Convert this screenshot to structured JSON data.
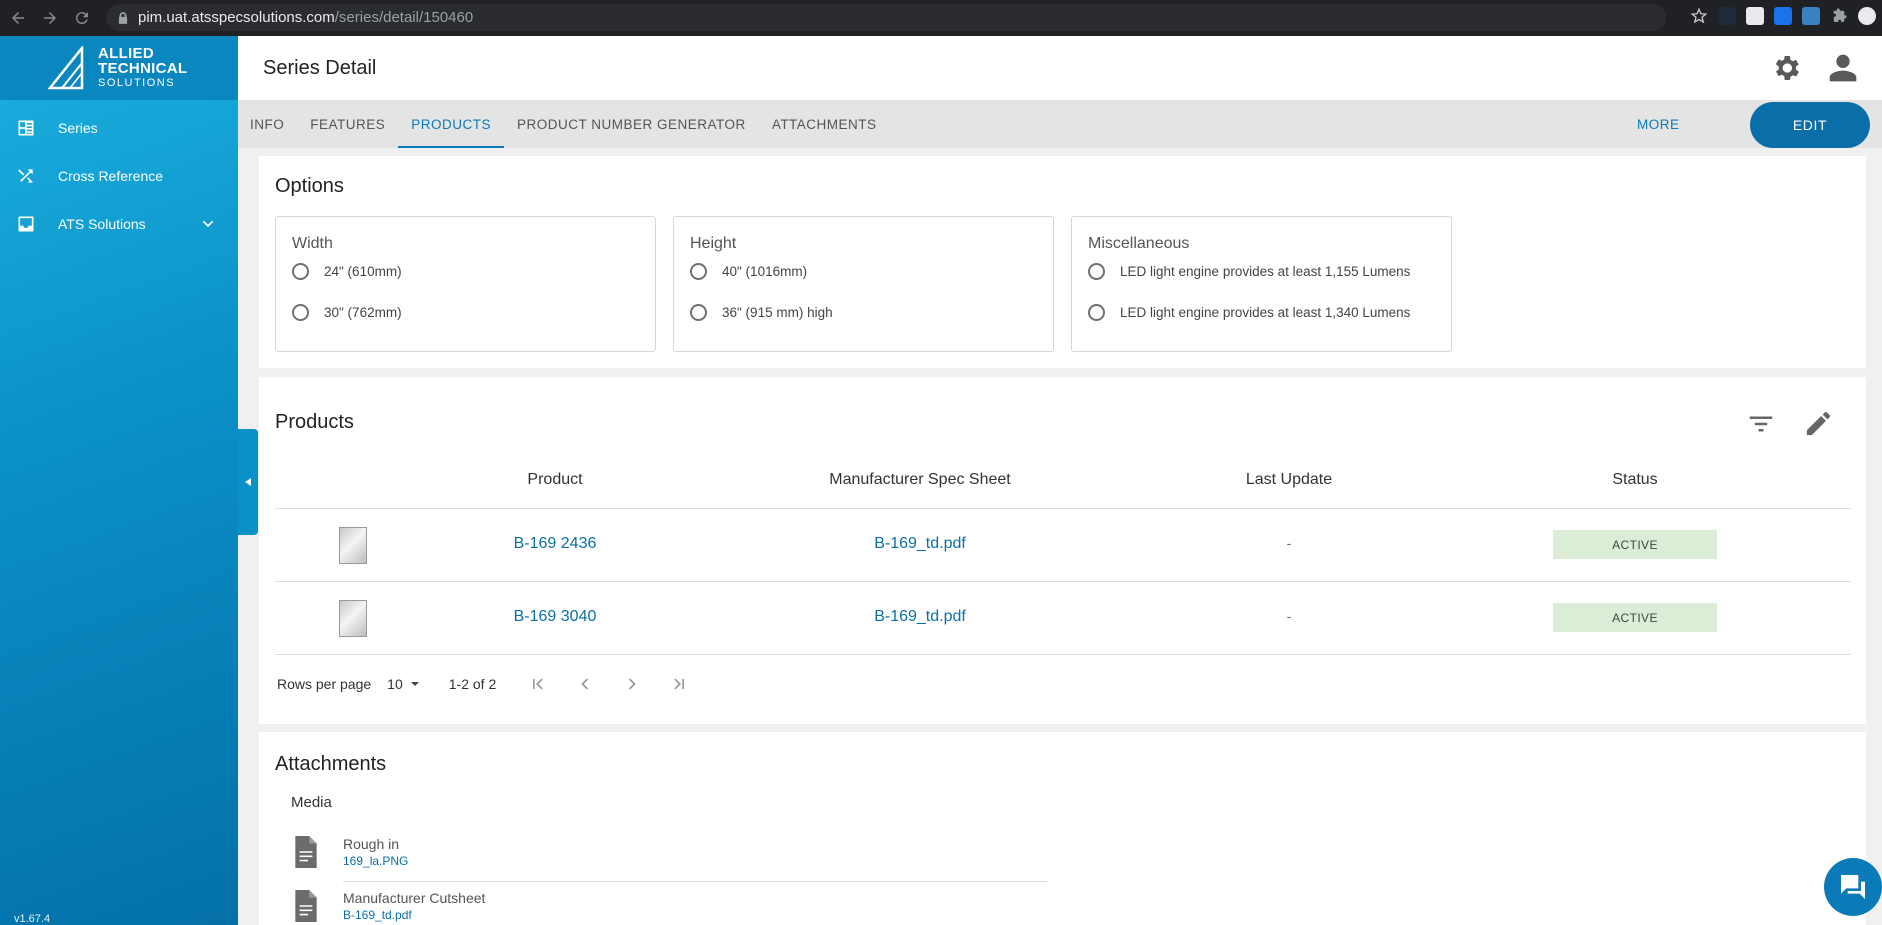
{
  "browser": {
    "url_host": "pim.uat.atsspecsolutions.com",
    "url_path": "/series/detail/150460"
  },
  "sidebar": {
    "logo": {
      "line1": "ALLIED",
      "line2": "TECHNICAL",
      "line3": "SOLUTIONS"
    },
    "items": [
      {
        "label": "Series",
        "icon": "series-icon"
      },
      {
        "label": "Cross Reference",
        "icon": "cross-reference-icon"
      },
      {
        "label": "ATS Solutions",
        "icon": "inbox-icon"
      }
    ],
    "version": "v1.67.4"
  },
  "header": {
    "title": "Series Detail"
  },
  "tabs": {
    "items": [
      {
        "label": "INFO"
      },
      {
        "label": "FEATURES"
      },
      {
        "label": "PRODUCTS",
        "active": true
      },
      {
        "label": "PRODUCT NUMBER GENERATOR"
      },
      {
        "label": "ATTACHMENTS"
      }
    ],
    "more": "MORE",
    "edit": "EDIT"
  },
  "options": {
    "title": "Options",
    "groups": [
      {
        "title": "Width",
        "choices": [
          "24\" (610mm)",
          "30\" (762mm)"
        ]
      },
      {
        "title": "Height",
        "choices": [
          "40\" (1016mm)",
          "36\" (915 mm) high"
        ]
      },
      {
        "title": "Miscellaneous",
        "choices": [
          "LED light engine provides at least 1,155 Lumens",
          "LED light engine provides at least 1,340 Lumens"
        ]
      }
    ]
  },
  "products": {
    "title": "Products",
    "columns": [
      "Product",
      "Manufacturer Spec Sheet",
      "Last Update",
      "Status"
    ],
    "rows": [
      {
        "product": "B-169 2436",
        "spec": "B-169_td.pdf",
        "updated": "-",
        "status": "ACTIVE"
      },
      {
        "product": "B-169 3040",
        "spec": "B-169_td.pdf",
        "updated": "-",
        "status": "ACTIVE"
      }
    ],
    "pagination": {
      "rows_label": "Rows per page",
      "rows_value": "10",
      "range": "1-2 of 2"
    }
  },
  "attachments": {
    "title": "Attachments",
    "section": "Media",
    "items": [
      {
        "label": "Rough in",
        "file": "169_la.PNG"
      },
      {
        "label": "Manufacturer Cutsheet",
        "file": "B-169_td.pdf"
      }
    ]
  }
}
